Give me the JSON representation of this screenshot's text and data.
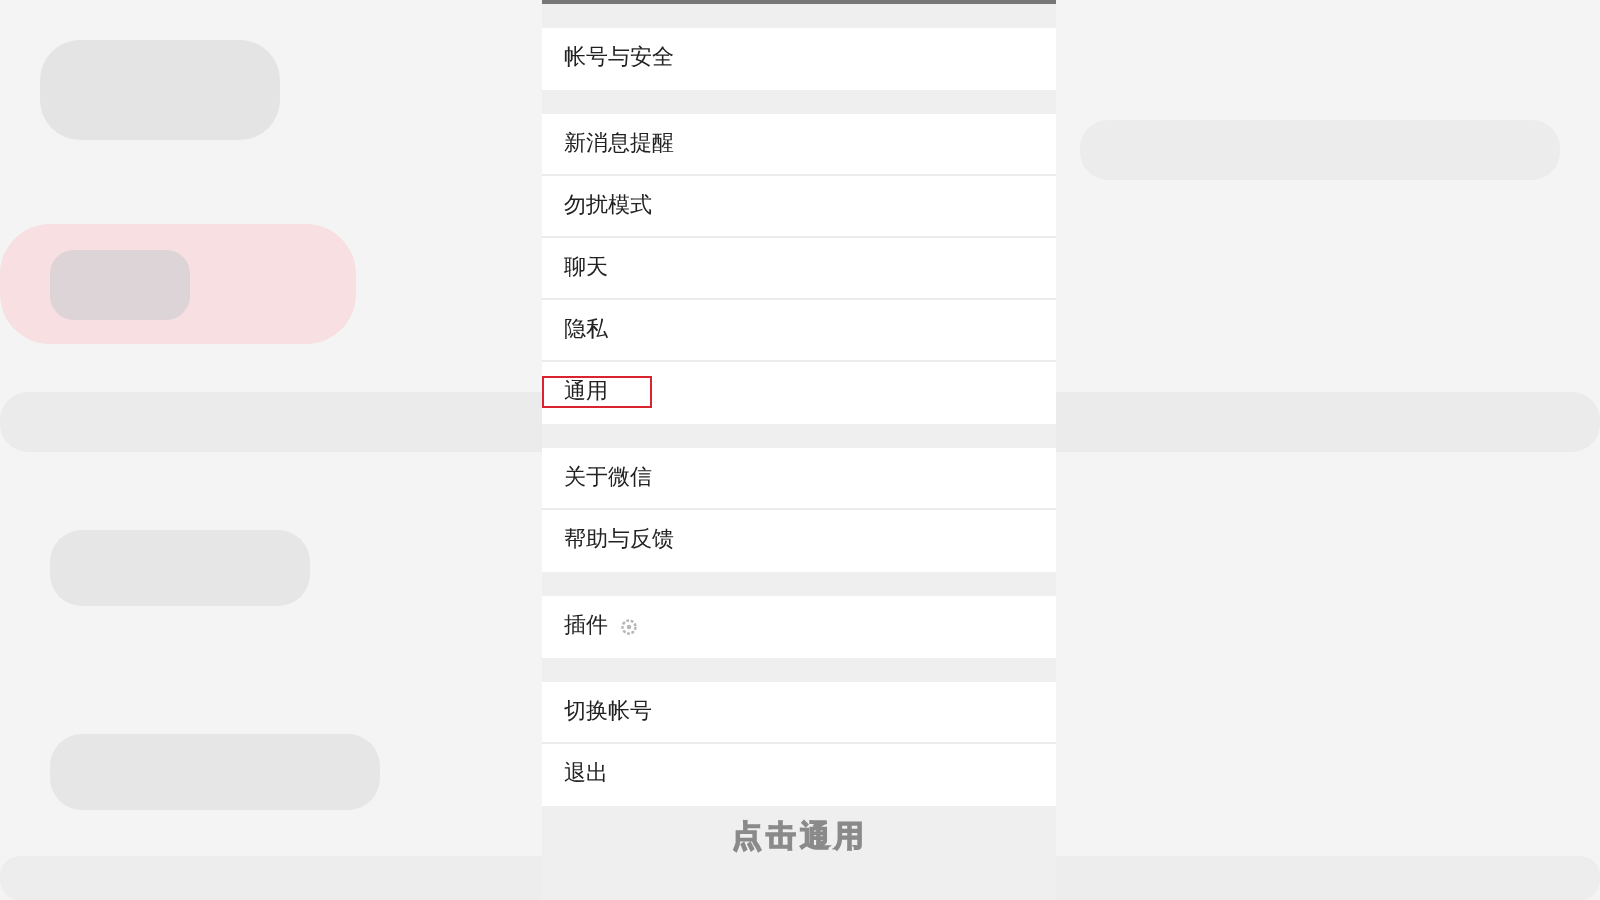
{
  "background": {
    "kind": "picture"
  },
  "settings_sections": [
    [
      {
        "label": "帐号与安全",
        "kind": "plain",
        "selected": false
      }
    ],
    [
      {
        "label": "新消息提醒",
        "kind": "plain",
        "selected": false
      },
      {
        "label": "勿扰模式",
        "kind": "plain",
        "selected": false
      },
      {
        "label": "聊天",
        "kind": "plain",
        "selected": false
      },
      {
        "label": "隐私",
        "kind": "plain",
        "selected": false
      },
      {
        "label": "通用",
        "kind": "plain",
        "selected": true
      }
    ],
    [
      {
        "label": "关于微信",
        "kind": "plain",
        "selected": false
      },
      {
        "label": "帮助与反馈",
        "kind": "plain",
        "selected": false
      }
    ],
    [
      {
        "label": "插件",
        "kind": "plugin",
        "selected": false
      }
    ],
    [
      {
        "label": "切换帐号",
        "kind": "plain",
        "selected": false
      },
      {
        "label": "退出",
        "kind": "plain",
        "selected": false
      }
    ]
  ],
  "caption": "点击通用"
}
